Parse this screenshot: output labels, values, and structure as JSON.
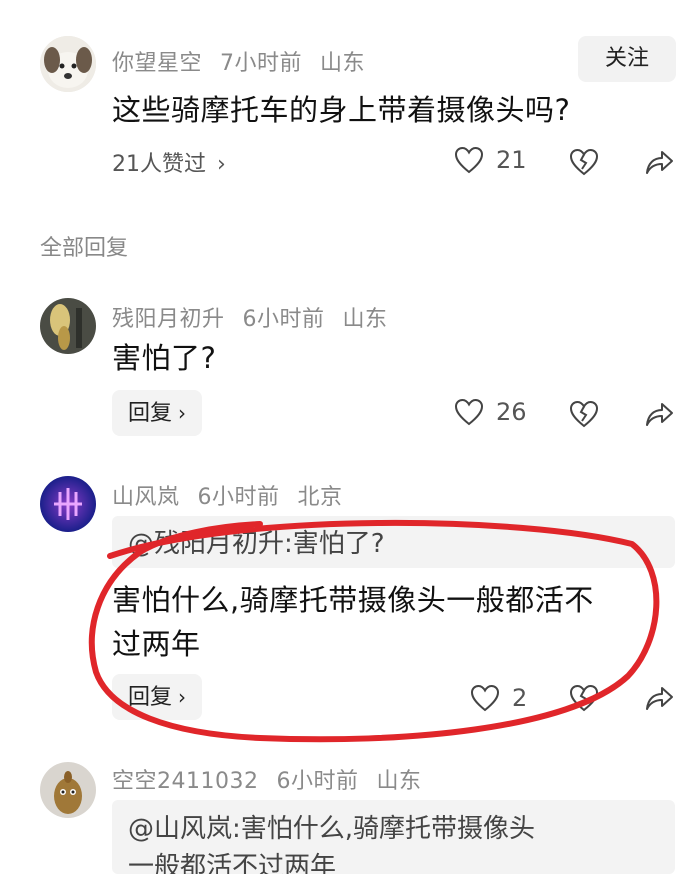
{
  "post": {
    "username": "你望星空",
    "time": "7小时前",
    "location": "山东",
    "follow_label": "关注",
    "text": "这些骑摩托车的身上带着摄像头吗?",
    "likers": "21人赞过",
    "likes": "21"
  },
  "section_label": "全部回复",
  "replies": [
    {
      "username": "残阳月初升",
      "time": "6小时前",
      "location": "山东",
      "text": "害怕了?",
      "reply_label": "回复",
      "likes": "26"
    },
    {
      "username": "山风岚",
      "time": "6小时前",
      "location": "北京",
      "quote": "@残阳月初升:害怕了?",
      "text_line1": "害怕什么,骑摩托带摄像头一般都活不",
      "text_line2": "过两年",
      "reply_label": "回复",
      "likes": "2"
    },
    {
      "username": "空空2411032",
      "time": "6小时前",
      "location": "山东",
      "quote_line1": "@山风岚:害怕什么,骑摩托带摄像头",
      "quote_line2": "一般都活不过两年"
    }
  ],
  "colors": {
    "annotation_circle": "#e0262a",
    "meta_text": "#8a8a8a"
  },
  "icons": [
    "heart-outline-icon",
    "broken-heart-icon",
    "share-arrow-icon",
    "chevron-right-icon"
  ]
}
